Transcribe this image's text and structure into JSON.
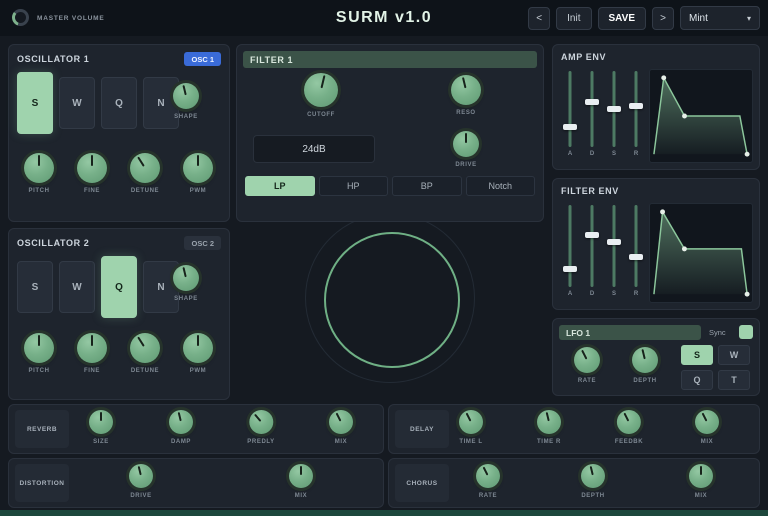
{
  "topbar": {
    "master_volume_label": "MASTER VOLUME",
    "title": "SURM v1.0",
    "prev_label": "<",
    "init_label": "Init",
    "save_label": "SAVE",
    "next_label": ">",
    "preset_value": "Mint",
    "chevron": "▾"
  },
  "osc1": {
    "title": "OSCILLATOR 1",
    "badge": "OSC 1",
    "waves": [
      "S",
      "W",
      "Q",
      "N"
    ],
    "selected_wave": "S",
    "shape": {
      "label": "SHAPE",
      "value": 0.45
    },
    "knobs": [
      {
        "label": "PITCH",
        "value": 0.5
      },
      {
        "label": "FINE",
        "value": 0.5
      },
      {
        "label": "DETUNE",
        "value": 0.38
      },
      {
        "label": "PWM",
        "value": 0.5
      }
    ]
  },
  "osc2": {
    "title": "OSCILLATOR 2",
    "badge": "OSC 2",
    "waves": [
      "S",
      "W",
      "Q",
      "N"
    ],
    "selected_wave": "Q",
    "shape": {
      "label": "SHAPE",
      "value": 0.45
    },
    "knobs": [
      {
        "label": "PITCH",
        "value": 0.5
      },
      {
        "label": "FINE",
        "value": 0.5
      },
      {
        "label": "DETUNE",
        "value": 0.38
      },
      {
        "label": "PWM",
        "value": 0.5
      }
    ]
  },
  "filter1": {
    "title": "FILTER 1",
    "cutoff": {
      "label": "CUTOFF",
      "value": 0.55
    },
    "reso": {
      "label": "RESO",
      "value": 0.45
    },
    "slope": "24dB",
    "drive": {
      "label": "DRIVE",
      "value": 0.5
    },
    "types": [
      "LP",
      "HP",
      "BP",
      "Notch"
    ],
    "selected_type": "LP"
  },
  "amp_env": {
    "title": "AMP ENV",
    "sliders": [
      {
        "label": "A",
        "value": 0.25
      },
      {
        "label": "D",
        "value": 0.6
      },
      {
        "label": "S",
        "value": 0.5
      },
      {
        "label": "R",
        "value": 0.55
      }
    ]
  },
  "filter_env": {
    "title": "FILTER ENV",
    "sliders": [
      {
        "label": "A",
        "value": 0.2
      },
      {
        "label": "D",
        "value": 0.65
      },
      {
        "label": "S",
        "value": 0.55
      },
      {
        "label": "R",
        "value": 0.35
      }
    ]
  },
  "lfo1": {
    "title": "LFO 1",
    "sync_label": "Sync",
    "sync_on": true,
    "rate": {
      "label": "RATE",
      "value": 0.4
    },
    "depth": {
      "label": "DEPTH",
      "value": 0.45
    },
    "waves": [
      "S",
      "W",
      "Q",
      "T"
    ],
    "selected_wave": "S"
  },
  "effects": {
    "reverb": {
      "title": "REVERB",
      "knobs": [
        {
          "label": "SIZE",
          "value": 0.5
        },
        {
          "label": "DAMP",
          "value": 0.45
        },
        {
          "label": "PREDLY",
          "value": 0.35
        },
        {
          "label": "MIX",
          "value": 0.4
        }
      ]
    },
    "delay": {
      "title": "DELAY",
      "knobs": [
        {
          "label": "TIME L",
          "value": 0.4
        },
        {
          "label": "TIME R",
          "value": 0.45
        },
        {
          "label": "FEEDBK",
          "value": 0.4
        },
        {
          "label": "MIX",
          "value": 0.4
        }
      ]
    },
    "distortion": {
      "title": "DISTORTION",
      "knobs": [
        {
          "label": "DRIVE",
          "value": 0.45
        },
        {
          "label": "MIX",
          "value": 0.5
        }
      ]
    },
    "chorus": {
      "title": "CHORUS",
      "knobs": [
        {
          "label": "RATE",
          "value": 0.4
        },
        {
          "label": "DEPTH",
          "value": 0.45
        },
        {
          "label": "MIX",
          "value": 0.5
        }
      ]
    }
  },
  "colors": {
    "accent": "#7eb28d",
    "selected": "#9fd3ad",
    "badge_blue": "#3a6bd8",
    "panel": "#1e242d",
    "background": "#151a21"
  }
}
